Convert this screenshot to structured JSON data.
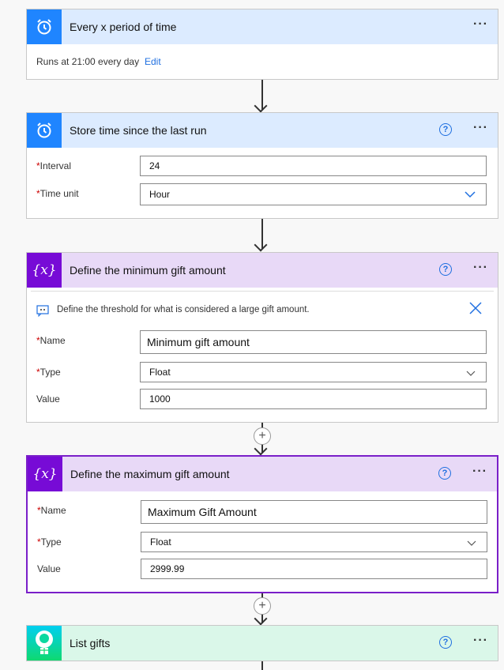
{
  "cards": [
    {
      "title": "Every x period of time",
      "summary": "Runs at 21:00 every day",
      "edit": "Edit"
    },
    {
      "title": "Store time since the last run",
      "fields": [
        {
          "label": "Interval",
          "value": "24"
        },
        {
          "label": "Time unit",
          "value": "Hour"
        }
      ]
    },
    {
      "title": "Define the minimum gift amount",
      "comment": "Define the threshold for what is considered a large gift amount.",
      "fields": [
        {
          "label": "Name",
          "value": "Minimum gift amount"
        },
        {
          "label": "Type",
          "value": "Float"
        },
        {
          "label": "Value",
          "value": "1000"
        }
      ]
    },
    {
      "title": "Define the maximum gift amount",
      "fields": [
        {
          "label": "Name",
          "value": "Maximum Gift Amount"
        },
        {
          "label": "Type",
          "value": "Float"
        },
        {
          "label": "Value",
          "value": "2999.99"
        }
      ]
    },
    {
      "title": "List gifts"
    }
  ],
  "req": "*",
  "help": "?",
  "more": "···",
  "plus": "+",
  "colors": {
    "recurrence": "#1f85ff",
    "variable": "#770bd6",
    "selected": "#7a1fc9",
    "link": "#1f6fe0"
  }
}
